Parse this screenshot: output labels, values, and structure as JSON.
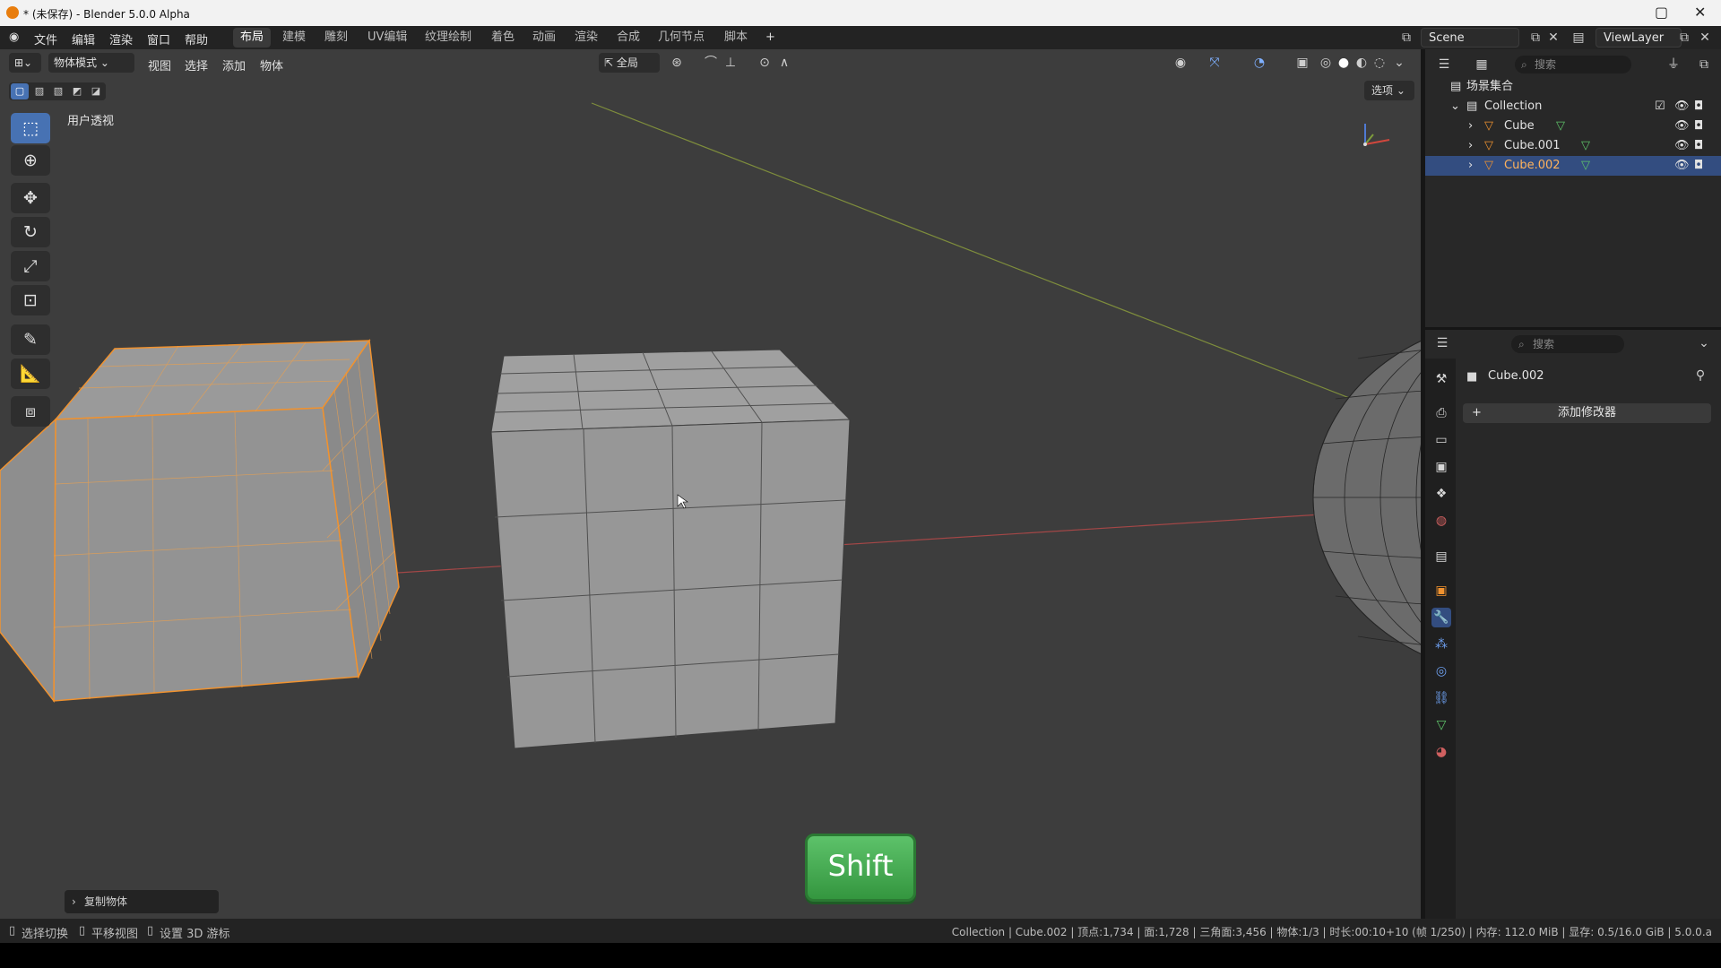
{
  "window": {
    "title": "* (未保存) - Blender 5.0.0 Alpha",
    "maximize_glyph": "▢",
    "close_glyph": "✕"
  },
  "menu": [
    "文件",
    "编辑",
    "渲染",
    "窗口",
    "帮助"
  ],
  "workspaces": [
    "布局",
    "建模",
    "雕刻",
    "UV编辑",
    "纹理绘制",
    "着色",
    "动画",
    "渲染",
    "合成",
    "几何节点",
    "脚本"
  ],
  "workspace_add": "+",
  "scene": {
    "name": "Scene",
    "view_layer": "ViewLayer"
  },
  "viewport": {
    "mode": "物体模式",
    "header_menus": [
      "视图",
      "选择",
      "添加",
      "物体"
    ],
    "orientation": "全局",
    "options_label": "选项",
    "view_label": "用户透视"
  },
  "outliner": {
    "search_placeholder": "搜索",
    "scene_collection": "场景集合",
    "collection": "Collection",
    "objects": [
      "Cube",
      "Cube.001",
      "Cube.002"
    ]
  },
  "properties": {
    "search_placeholder": "搜索",
    "object_name": "Cube.002",
    "add_modifier": "添加修改器"
  },
  "last_operator": "复制物体",
  "key_overlay": "Shift",
  "status": {
    "left": [
      "选择切换",
      "平移视图",
      "设置 3D 游标"
    ],
    "right": "Collection | Cube.002 | 顶点:1,734 | 面:1,728 | 三角面:3,456 | 物体:1/3 | 时长:00:10+10 (帧 1/250) | 内存: 112.0 MiB | 显存: 0.5/16.0 GiB | 5.0.0.a"
  },
  "colors": {
    "selection": "#f0922f",
    "active_highlight": "#334d80",
    "tool_active": "#4772b3",
    "viewport_bg": "#3d3d3d",
    "x_axis": "#c94a4a",
    "y_axis": "#8a9a3a"
  }
}
